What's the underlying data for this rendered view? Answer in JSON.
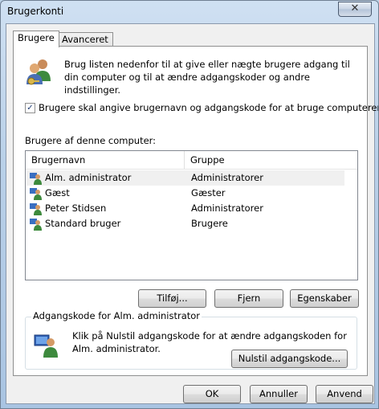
{
  "window": {
    "title": "Brugerkonti",
    "close_glyph": "✕"
  },
  "tabs": [
    {
      "label": "Brugere"
    },
    {
      "label": "Avanceret"
    }
  ],
  "intro_text": "Brug listen nedenfor til at give eller nægte brugere adgang til din computer og til at ændre adgangskoder og andre indstillinger.",
  "require_login": {
    "label": "Brugere skal angive brugernavn og adgangskode for at bruge computeren",
    "checked": true,
    "glyph": "✓"
  },
  "users_label": "Brugere af denne computer:",
  "columns": {
    "name": "Brugernavn",
    "group": "Gruppe"
  },
  "users": [
    {
      "name": "Alm. administrator",
      "group": "Administratorer"
    },
    {
      "name": "Gæst",
      "group": "Gæster"
    },
    {
      "name": "Peter Stidsen",
      "group": "Administratorer"
    },
    {
      "name": "Standard bruger",
      "group": "Brugere"
    }
  ],
  "list_buttons": {
    "add": "Tilføj...",
    "remove": "Fjern",
    "properties": "Egenskaber"
  },
  "password": {
    "title": "Adgangskode for Alm. administrator",
    "text": "Klik på Nulstil adgangskode for at ændre adgangskoden for Alm. administrator.",
    "reset_button": "Nulstil adgangskode..."
  },
  "footer": {
    "ok": "OK",
    "cancel": "Annuller",
    "apply": "Anvend"
  },
  "icons": {
    "users": "users-icon",
    "user": "user-icon",
    "password_user": "computer-user-icon",
    "close": "close-icon"
  }
}
